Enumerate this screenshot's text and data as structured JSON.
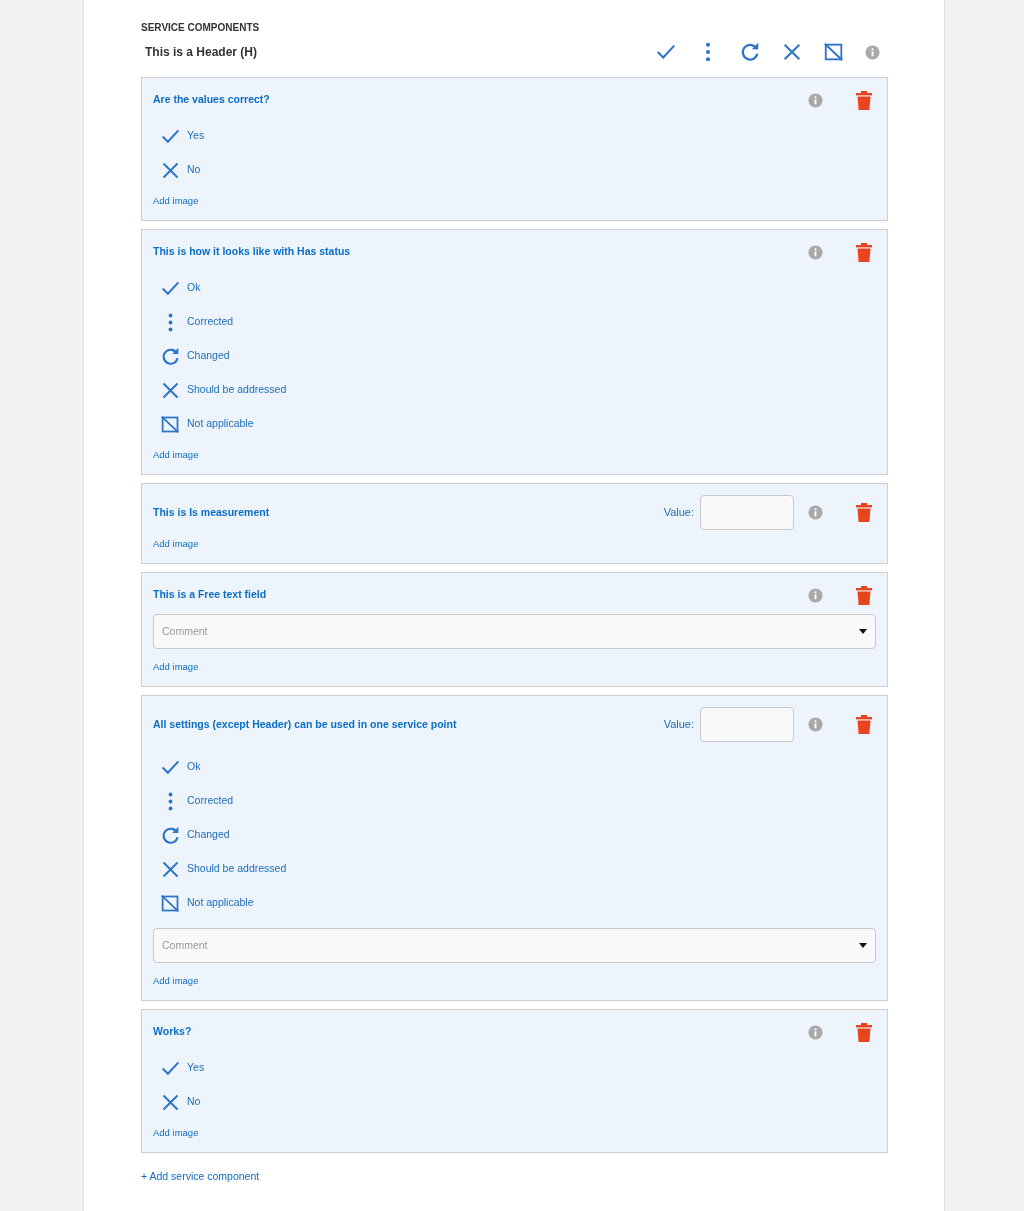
{
  "section_title": "SERVICE COMPONENTS",
  "header": {
    "title": "This is a Header (H)",
    "actions": [
      {
        "kind": "check"
      },
      {
        "kind": "dots"
      },
      {
        "kind": "refresh"
      },
      {
        "kind": "cross"
      },
      {
        "kind": "na"
      }
    ]
  },
  "components": [
    {
      "title": "Are the values correct?",
      "options": [
        {
          "kind": "check",
          "label": "Yes"
        },
        {
          "kind": "cross",
          "label": "No"
        }
      ],
      "add_image": "Add image"
    },
    {
      "title": "This is how it looks like with Has status",
      "options": [
        {
          "kind": "check",
          "label": "Ok"
        },
        {
          "kind": "dots",
          "label": "Corrected"
        },
        {
          "kind": "refresh",
          "label": "Changed"
        },
        {
          "kind": "cross",
          "label": "Should be addressed"
        },
        {
          "kind": "na",
          "label": "Not applicable"
        }
      ],
      "add_image": "Add image"
    },
    {
      "title": "This is Is measurement",
      "value_label": "Value:",
      "add_image": "Add image"
    },
    {
      "title": "This is a Free text field",
      "comment": {
        "placeholder": "Comment"
      },
      "add_image": "Add image"
    },
    {
      "title": "All settings (except Header) can be used in one service point",
      "value_label": "Value:",
      "options": [
        {
          "kind": "check",
          "label": "Ok"
        },
        {
          "kind": "dots",
          "label": "Corrected"
        },
        {
          "kind": "refresh",
          "label": "Changed"
        },
        {
          "kind": "cross",
          "label": "Should be addressed"
        },
        {
          "kind": "na",
          "label": "Not applicable"
        }
      ],
      "comment": {
        "placeholder": "Comment"
      },
      "add_image": "Add image"
    },
    {
      "title": "Works?",
      "options": [
        {
          "kind": "check",
          "label": "Yes"
        },
        {
          "kind": "cross",
          "label": "No"
        }
      ],
      "add_image": "Add image"
    }
  ],
  "add_component": "+ Add service component"
}
